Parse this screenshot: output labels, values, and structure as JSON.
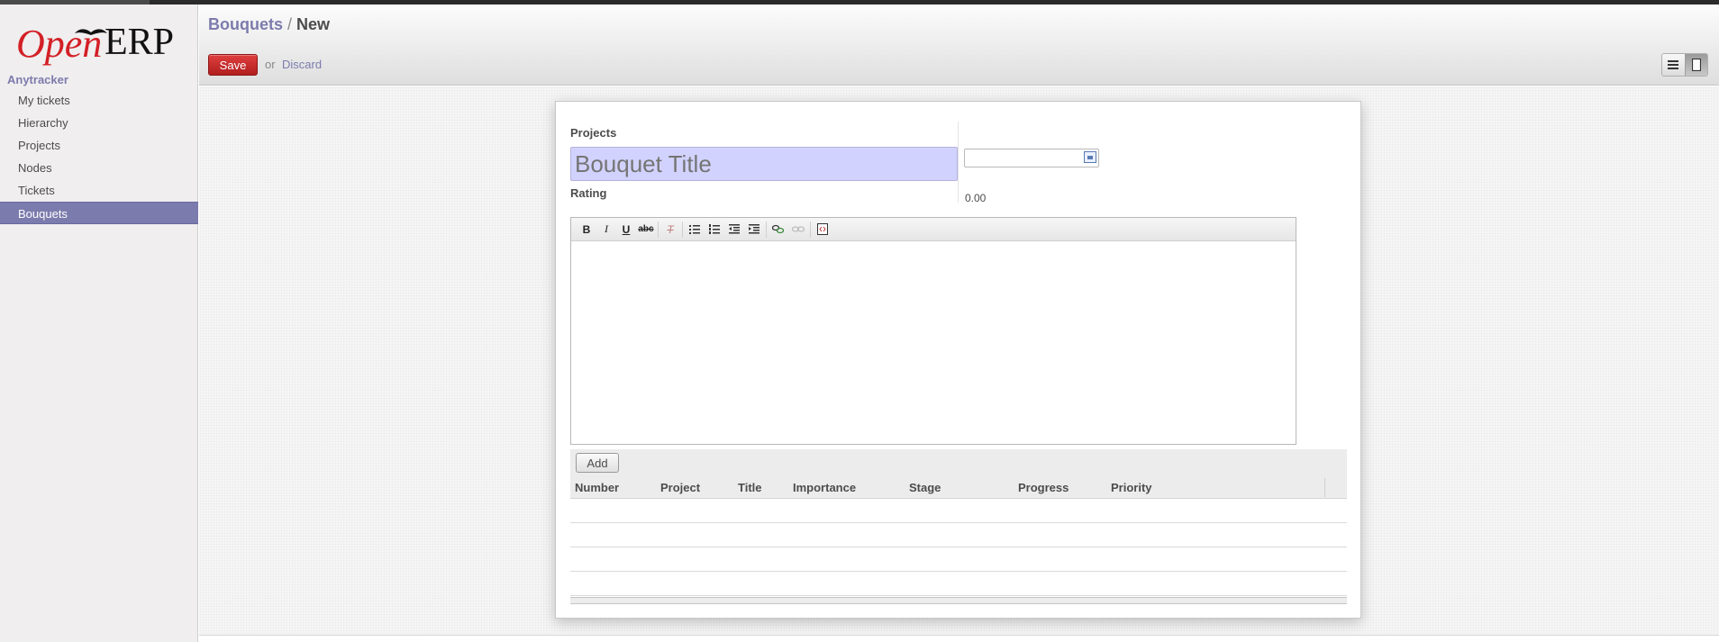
{
  "app": {
    "logo_text_open": "Open",
    "logo_text_erp": "ERP"
  },
  "sidebar": {
    "section_title": "Anytracker",
    "items": [
      {
        "label": "My tickets"
      },
      {
        "label": "Hierarchy"
      },
      {
        "label": "Projects"
      },
      {
        "label": "Nodes"
      },
      {
        "label": "Tickets"
      },
      {
        "label": "Bouquets",
        "active": true
      }
    ]
  },
  "header": {
    "breadcrumb_parent": "Bouquets",
    "breadcrumb_separator": " / ",
    "breadcrumb_current": "New",
    "save_label": "Save",
    "or_text": "or",
    "discard_label": "Discard"
  },
  "form": {
    "projects_label": "Projects",
    "title_placeholder": "Bouquet Title",
    "title_value": "",
    "date_value": "",
    "rating_label": "Rating",
    "rating_value": "0.00"
  },
  "editor": {
    "toolbar_icons": [
      "bold-icon",
      "italic-icon",
      "underline-icon",
      "strikethrough-icon",
      "remove-format-icon",
      "bullet-list-icon",
      "numbered-list-icon",
      "outdent-icon",
      "indent-icon",
      "link-icon",
      "unlink-icon",
      "source-icon"
    ],
    "bold_glyph": "B",
    "italic_glyph": "I",
    "underline_glyph": "U",
    "strike_glyph": "abc",
    "remove_format_glyph": "T"
  },
  "tickets": {
    "add_label": "Add",
    "columns": [
      "Number",
      "Project",
      "Title",
      "Importance",
      "Stage",
      "Progress",
      "Priority"
    ],
    "rows": []
  },
  "colors": {
    "accent": "#7c7bad",
    "save_button": "#c02c2c",
    "title_field_bg": "#d2d2ff",
    "logo_red": "#d31f26"
  }
}
